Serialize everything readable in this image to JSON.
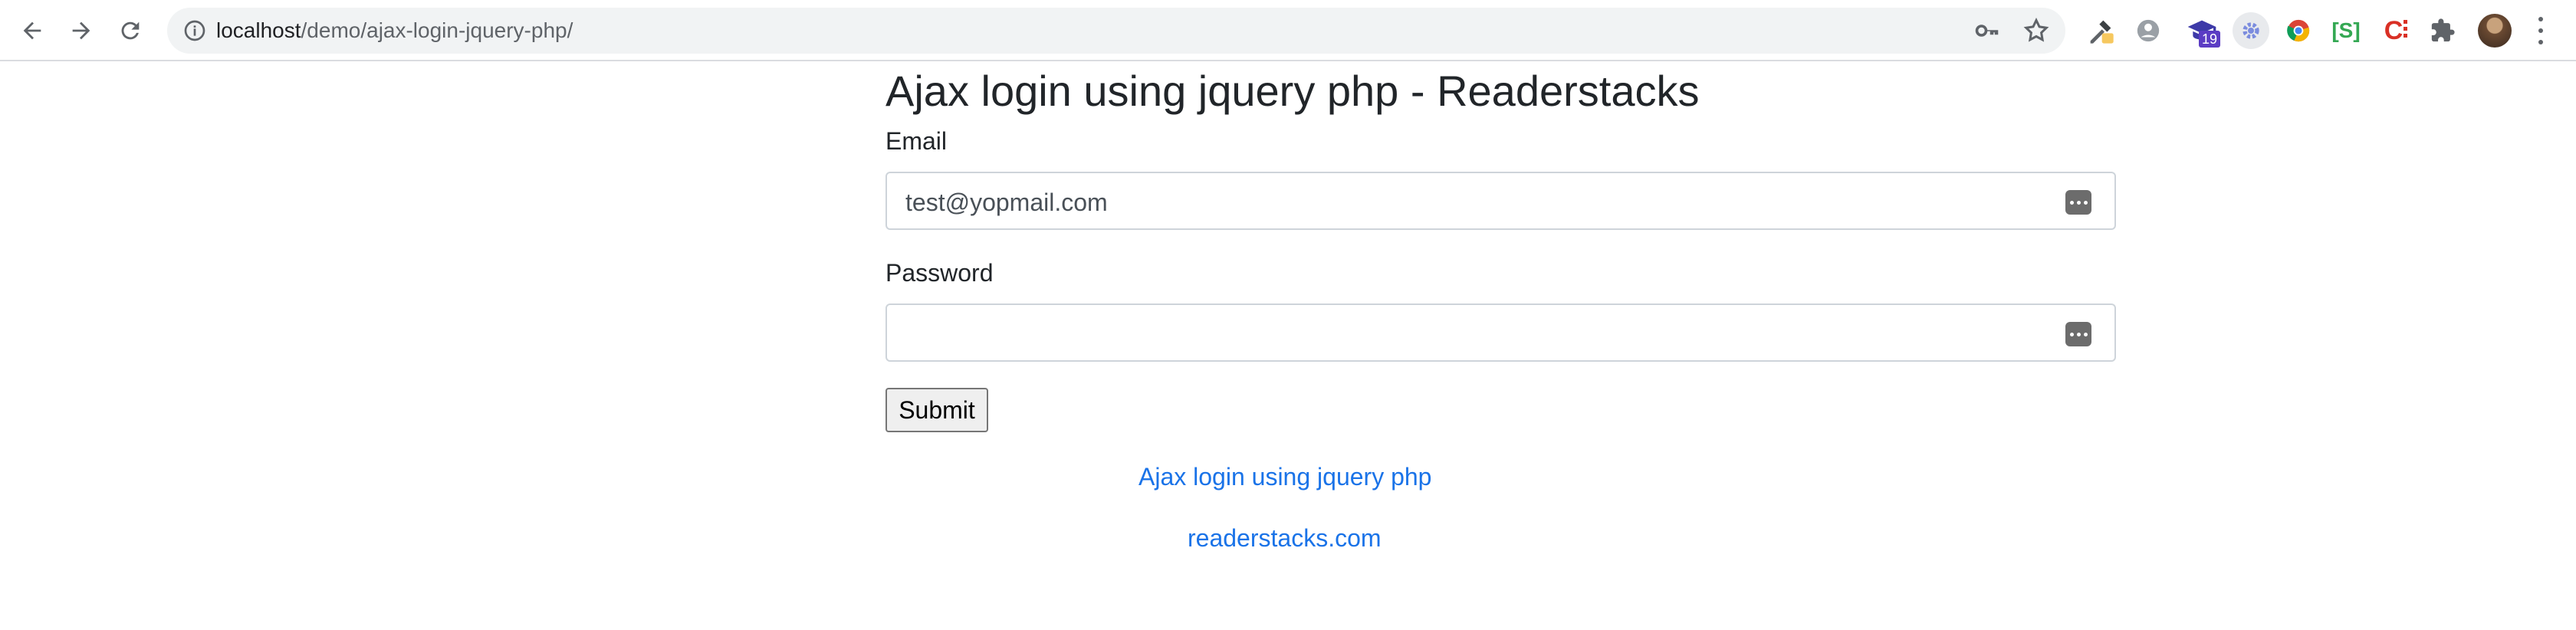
{
  "browser": {
    "url_host": "localhost",
    "url_path": "/demo/ajax-login-jquery-php/",
    "extension_badge": "19",
    "icons": [
      "back-icon",
      "forward-icon",
      "reload-icon",
      "info-icon",
      "key-icon",
      "star-icon",
      "eyedropper-icon",
      "profile-icon",
      "graduation-icon",
      "gear-icon",
      "chrome-icon",
      "s-icon",
      "c-icon",
      "puzzle-icon",
      "avatar",
      "menu-icon"
    ],
    "ext_s_label": "[S]",
    "ext_c_label": "C"
  },
  "page": {
    "title": "Ajax login using jquery php - Readerstacks",
    "email_label": "Email",
    "email_value": "test@yopmail.com",
    "password_label": "Password",
    "password_value": "",
    "submit_label": "Submit",
    "link1": "Ajax login using jquery php",
    "link2": "readerstacks.com"
  },
  "colors": {
    "link": "#1a73e8",
    "text": "#212529",
    "omnibox": "#f1f3f4"
  }
}
